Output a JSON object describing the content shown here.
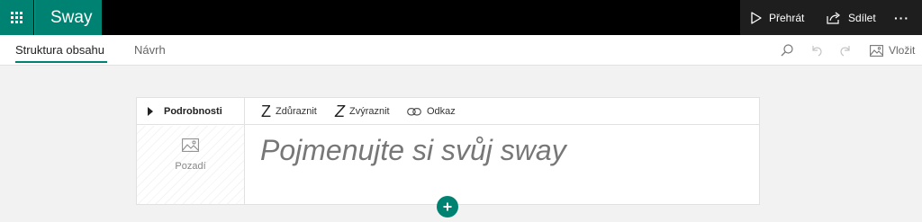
{
  "app": {
    "name": "Sway"
  },
  "topbar": {
    "play_label": "Přehrát",
    "share_label": "Sdílet",
    "more_label": "···"
  },
  "tabs": [
    {
      "label": "Struktura obsahu",
      "active": true
    },
    {
      "label": "Návrh",
      "active": false
    }
  ],
  "toolbar": {
    "insert_label": "Vložit",
    "icons": [
      "search-icon",
      "undo-icon",
      "redo-icon",
      "image-icon"
    ]
  },
  "card": {
    "details_label": "Podrobnosti",
    "background_label": "Pozadí",
    "format": {
      "emphasize_label": "Zdůraznit",
      "highlight_label": "Zvýraznit",
      "link_label": "Odkaz"
    },
    "title_placeholder": "Pojmenujte si svůj sway"
  },
  "colors": {
    "accent": "#008272",
    "topbar": "#000000"
  }
}
